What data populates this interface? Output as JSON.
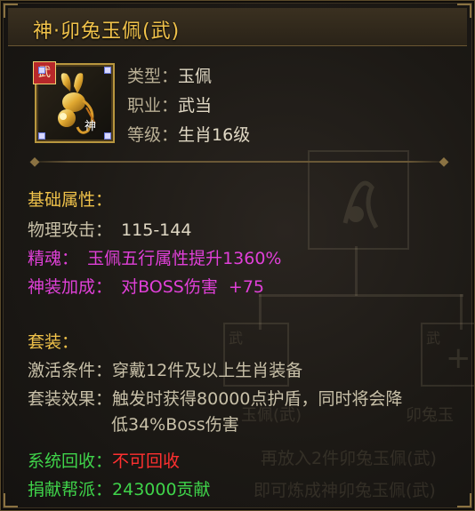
{
  "title": "神·卯兔玉佩(武)",
  "icon": {
    "name": "jade-rabbit-pendant-icon",
    "badge": "武",
    "stamp": "神"
  },
  "basic_info": {
    "type_label": "类型：",
    "type_value": "玉佩",
    "class_label": "职业：",
    "class_value": "武当",
    "level_label": "等级：",
    "level_value": "生肖16级"
  },
  "base_attributes": {
    "heading": "基础属性：",
    "physical_attack_label": "物理攻击：",
    "physical_attack_value": "115-144",
    "essence_label": "精魂：",
    "essence_value": "玉佩五行属性提升1360%",
    "divine_bonus_label": "神装加成：",
    "divine_bonus_value": "对BOSS伤害  +75"
  },
  "set": {
    "heading": "套装：",
    "activation_label": "激活条件：",
    "activation_value": "穿戴12件及以上生肖装备",
    "effect_label": "套装效果：",
    "effect_line1": "触发时获得80000点护盾，同时将会降",
    "effect_line2": "低34%Boss伤害"
  },
  "footer": {
    "recycle_label": "系统回收：",
    "recycle_value": "不可回收",
    "donate_label": "捐献帮派：",
    "donate_value": "243000贡献"
  },
  "background_ui": {
    "left_slot_label": "武",
    "right_slot_label": "武",
    "item_caption_left": "玉佩(武)",
    "item_caption_right": "卯兔玉",
    "hint_line1": "再放入2件卯兔玉佩(武)",
    "hint_line2": "即可炼成神卯兔玉佩(武)"
  },
  "colors": {
    "title": "#f0c24a",
    "section_heading": "#f0c24a",
    "magenta_attr": "#e040d8",
    "green_footer": "#3fd34a",
    "red_value": "#ff3030"
  }
}
